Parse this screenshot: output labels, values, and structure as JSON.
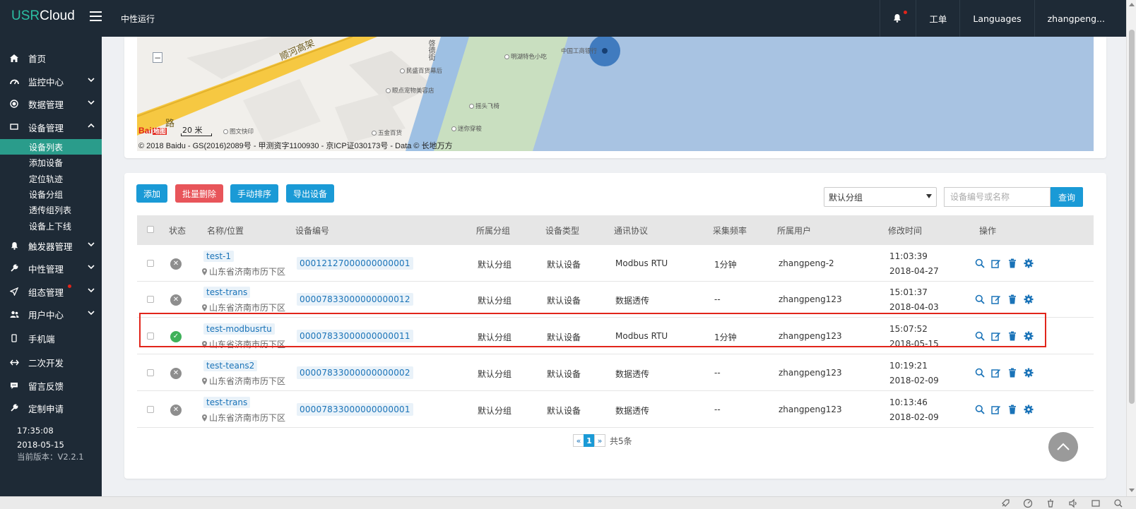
{
  "header": {
    "logo_usr": "USR",
    "logo_cloud": "Cloud",
    "title": "中性运行",
    "work_order": "工单",
    "languages": "Languages",
    "user": "zhangpeng..."
  },
  "sidebar": {
    "items": [
      {
        "label": "首页",
        "icon": "home-icon"
      },
      {
        "label": "监控中心",
        "icon": "dashboard-icon"
      },
      {
        "label": "数据管理",
        "icon": "record-icon"
      },
      {
        "label": "设备管理",
        "icon": "monitor-icon"
      },
      {
        "label": "触发器管理",
        "icon": "bell-icon"
      },
      {
        "label": "中性管理",
        "icon": "tools-icon"
      },
      {
        "label": "组态管理",
        "icon": "send-icon"
      },
      {
        "label": "用户中心",
        "icon": "users-icon"
      },
      {
        "label": "手机端",
        "icon": "mobile-icon"
      },
      {
        "label": "二次开发",
        "icon": "code-icon"
      },
      {
        "label": "留言反馈",
        "icon": "comment-icon"
      },
      {
        "label": "定制申请",
        "icon": "wrench-icon"
      }
    ],
    "sub_items": [
      "设备列表",
      "添加设备",
      "定位轨迹",
      "设备分组",
      "透传组列表",
      "设备上下线"
    ],
    "time": "17:35:08",
    "date": "2018-05-15",
    "version": "当前版本：V2.2.1"
  },
  "map": {
    "road_label": "顺河高架",
    "road_label2": "路",
    "street": "啓德街",
    "poi": [
      "民盛百货幕后",
      "眼点宠物美容店",
      "图文快印",
      "五金百货",
      "摇头飞椅",
      "迷你穿梭",
      "明湖特色小吃",
      "中国工商银行"
    ],
    "scale": "20 米",
    "baidu_logo_a": "Bai",
    "baidu_logo_b": "地图",
    "copyright": "© 2018 Baidu - GS(2016)2089号 - 甲测资字1100930 - 京ICP证030173号 - Data © 长地万方",
    "zoom_out": "−"
  },
  "toolbar": {
    "add": "添加",
    "batch_delete": "批量删除",
    "manual_sort": "手动排序",
    "export": "导出设备",
    "group_selected": "默认分组",
    "search_placeholder": "设备编号或名称",
    "search_btn": "查询"
  },
  "table": {
    "headers": [
      "状态",
      "名称/位置",
      "设备编号",
      "所属分组",
      "设备类型",
      "通讯协议",
      "采集频率",
      "所属用户",
      "修改时间",
      "操作"
    ],
    "rows": [
      {
        "online": false,
        "name": "test-1",
        "location": "山东省济南市历下区",
        "device_no": "00012127000000000001",
        "group": "默认分组",
        "type": "默认设备",
        "protocol": "Modbus RTU",
        "freq": "1分钟",
        "user": "zhangpeng-2",
        "time": "11:03:39",
        "date": "2018-04-27"
      },
      {
        "online": false,
        "name": "test-trans",
        "location": "山东省济南市历下区",
        "device_no": "00007833000000000012",
        "group": "默认分组",
        "type": "默认设备",
        "protocol": "数据透传",
        "freq": "--",
        "user": "zhangpeng123",
        "time": "15:01:37",
        "date": "2018-04-03"
      },
      {
        "online": true,
        "name": "test-modbusrtu",
        "location": "山东省济南市历下区",
        "device_no": "00007833000000000011",
        "group": "默认分组",
        "type": "默认设备",
        "protocol": "Modbus RTU",
        "freq": "1分钟",
        "user": "zhangpeng123",
        "time": "15:07:52",
        "date": "2018-05-15"
      },
      {
        "online": false,
        "name": "test-teans2",
        "location": "山东省济南市历下区",
        "device_no": "00007833000000000002",
        "group": "默认分组",
        "type": "默认设备",
        "protocol": "数据透传",
        "freq": "--",
        "user": "zhangpeng123",
        "time": "10:19:21",
        "date": "2018-02-09"
      },
      {
        "online": false,
        "name": "test-trans",
        "location": "山东省济南市历下区",
        "device_no": "00007833000000000001",
        "group": "默认分组",
        "type": "默认设备",
        "protocol": "数据透传",
        "freq": "--",
        "user": "zhangpeng123",
        "time": "10:13:46",
        "date": "2018-02-09"
      }
    ]
  },
  "pager": {
    "prev": "«",
    "current": "1",
    "next": "»",
    "total": "共5条"
  },
  "colors": {
    "sidebar_bg": "#1e2a36",
    "accent": "#2a9c8b",
    "primary": "#1a9ad6",
    "danger": "#e8555a",
    "highlight_border": "#e1251b"
  }
}
